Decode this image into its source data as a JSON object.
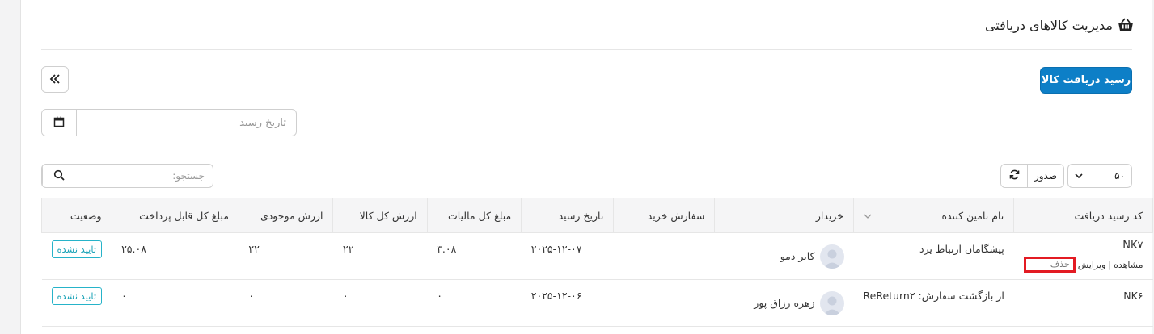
{
  "header": {
    "title": "مدیریت کالاهای دریافتی",
    "icon": "basket-icon"
  },
  "toolbar": {
    "primary_button": "رسید دریافت کالا"
  },
  "filters": {
    "date_placeholder": "تاریخ رسید",
    "search_placeholder": "جستجو:"
  },
  "tools": {
    "per_page": "۵۰",
    "export_label": "صدور"
  },
  "table": {
    "headers": {
      "code": "کد رسید دریافت",
      "supplier": "نام تامین کننده",
      "buyer": "خریدار",
      "order": "سفارش خرید",
      "date": "تاریخ رسید",
      "tax": "مبلغ کل مالیات",
      "goods": "ارزش کل کالا",
      "stock": "ارزش موجودی",
      "payable": "مبلغ کل قابل پرداخت",
      "status": "وضعیت"
    },
    "rows": [
      {
        "code": "NK۷",
        "actions": {
          "view": "مشاهده",
          "sep": "|",
          "edit": "ویرایش",
          "delete": "حذف"
        },
        "supplier": "پیشگامان ارتباط یزد",
        "buyer": "کابر دمو",
        "order": "",
        "date": "۲۰۲۵-۱۲-۰۷",
        "tax": "۳.۰۸",
        "goods": "۲۲",
        "stock": "۲۲",
        "payable": "۲۵.۰۸",
        "status": "تایید نشده"
      },
      {
        "code": "NK۶",
        "supplier": "از بازگشت سفارش: ReReturn۲",
        "buyer": "زهره رزاق پور",
        "order": "",
        "date": "۲۰۲۵-۱۲-۰۶",
        "tax": "۰",
        "goods": "۰",
        "stock": "۰",
        "payable": "۰",
        "status": "تایید نشده"
      }
    ]
  },
  "colors": {
    "primary": "#0d7fc7",
    "badge": "#26b3c9",
    "highlight": "#e31b23"
  }
}
